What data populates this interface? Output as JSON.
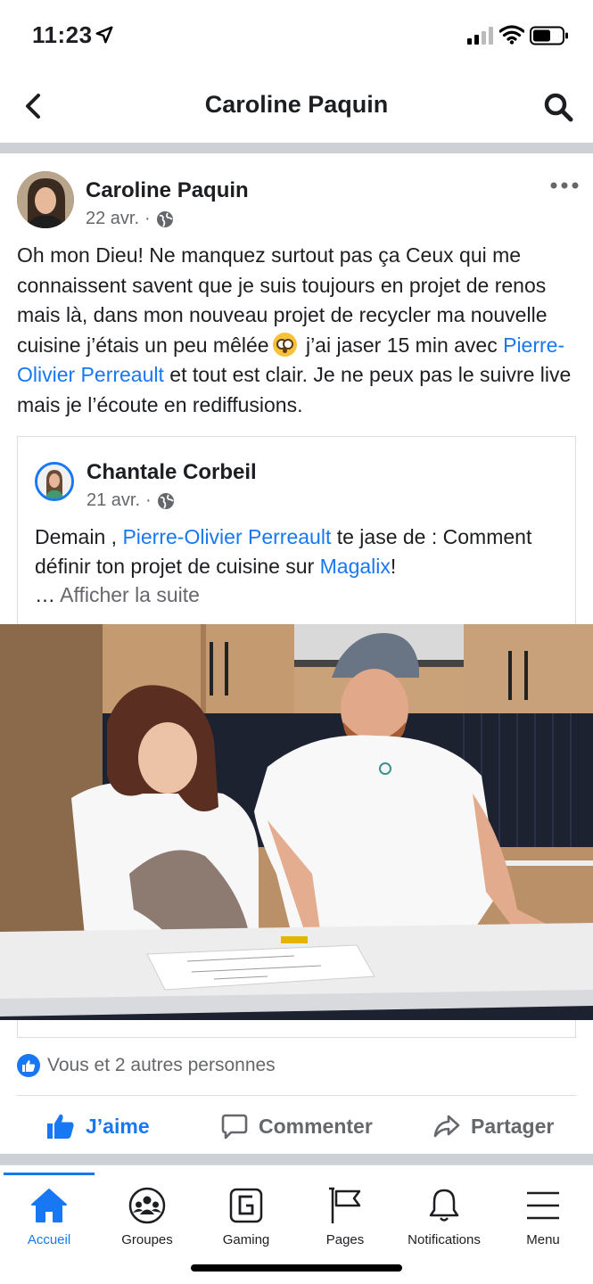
{
  "status_bar": {
    "time": "11:23"
  },
  "header": {
    "title": "Caroline Paquin"
  },
  "post": {
    "author": "Caroline Paquin",
    "date": "22 avr.",
    "separator": "·",
    "text": {
      "part1": "Oh mon Dieu! Ne manquez surtout pas ça   Ceux qui me connaissent savent que je suis toujours en projet de renos mais là, dans mon nouveau projet de recycler ma nouvelle cuisine j’étais un peu mêlée",
      "part2": " j’ai jaser 15 min avec ",
      "mention": "Pierre-Olivier Perreault",
      "part3": " et tout est clair. Je ne peux pas le suivre live mais je l’écoute en rediffusions."
    },
    "shared": {
      "author": "Chantale Corbeil",
      "date": "21 avr.",
      "separator": "·",
      "text_intro": "Demain , ",
      "mention": "Pierre-Olivier Perreault",
      "text_mid": " te jase de : Comment définir ton projet de cuisine sur ",
      "page_link": "Magalix",
      "text_end": "!",
      "ellipsis": "… ",
      "see_more": "Afficher la suite"
    },
    "reactions_text": "Vous et 2 autres personnes",
    "actions": {
      "like": "J’aime",
      "comment": "Commenter",
      "share": "Partager"
    }
  },
  "tab_bar": {
    "tabs": [
      {
        "label": "Accueil",
        "icon": "home-icon",
        "active": true
      },
      {
        "label": "Groupes",
        "icon": "groups-icon"
      },
      {
        "label": "Gaming",
        "icon": "gaming-icon"
      },
      {
        "label": "Pages",
        "icon": "flag-icon"
      },
      {
        "label": "Notifications",
        "icon": "bell-icon"
      },
      {
        "label": "Menu",
        "icon": "hamburger-icon"
      }
    ]
  },
  "colors": {
    "brand_blue": "#1877f2",
    "secondary_text": "#65676b",
    "divider": "#cdd0d4"
  }
}
